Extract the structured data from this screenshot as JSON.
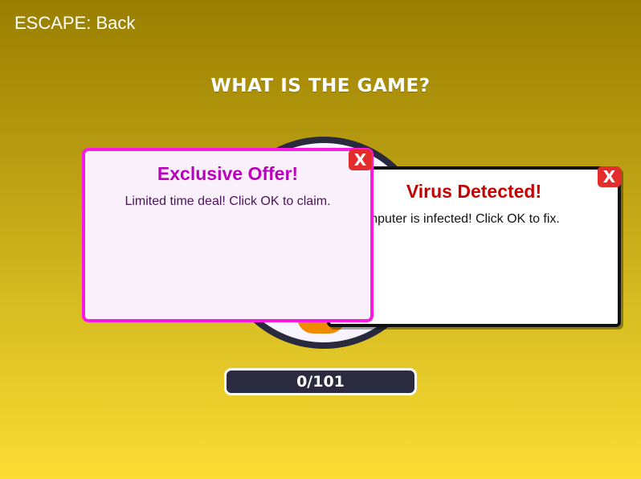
{
  "escape_hint": "ESCAPE: Back",
  "question": "WHAT IS THE GAME?",
  "popups": {
    "virus": {
      "title": "Virus Detected!",
      "message": "Your computer is infected! Click OK to fix.",
      "close_label": "X"
    },
    "offer": {
      "title": "Exclusive Offer!",
      "message": "Limited time deal! Click OK to claim.",
      "close_label": "X"
    }
  },
  "progress": {
    "current": 0,
    "total": 101,
    "label": "0/101"
  },
  "colors": {
    "background_top": "#9a7e00",
    "background_bottom": "#fbdd34",
    "offer_border": "#ff18e6",
    "virus_title": "#c40000",
    "close_button": "#e32c2c",
    "progress_bg": "#2b2b40",
    "wheel_ring": "#2a2a3e",
    "wheel_accent": "#f08a00"
  }
}
